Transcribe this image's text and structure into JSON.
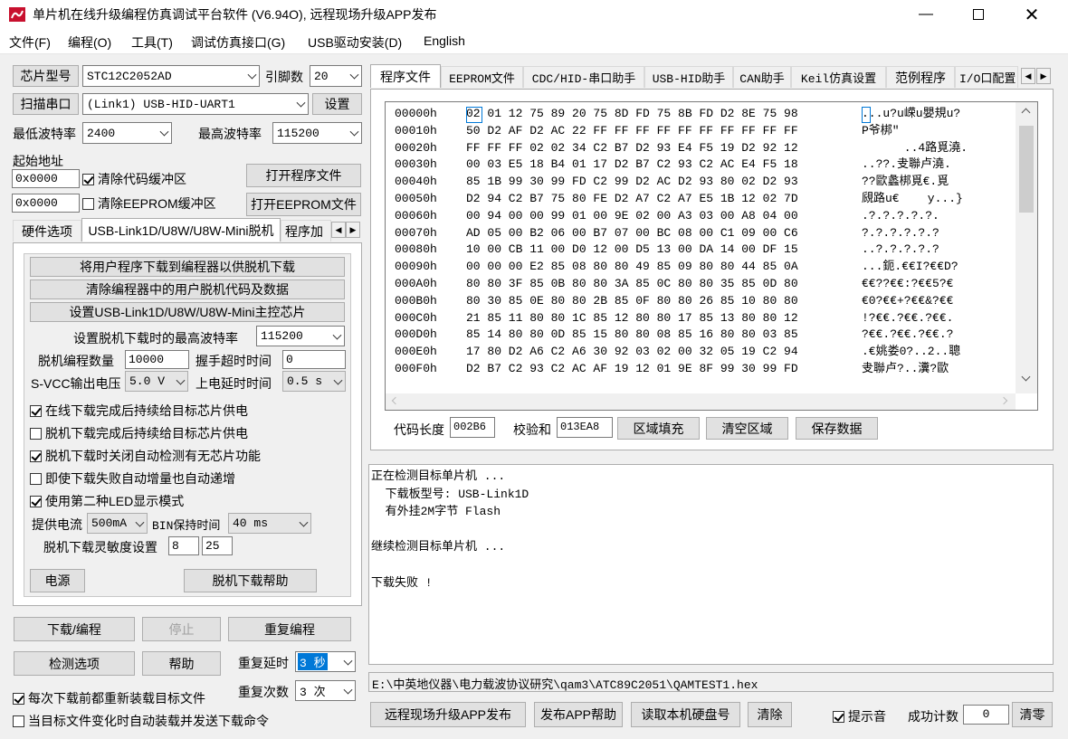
{
  "window": {
    "title": "单片机在线升级编程仿真调试平台软件 (V6.94O), 远程现场升级APP发布"
  },
  "menu": [
    "文件(F)",
    "编程(O)",
    "工具(T)",
    "调试仿真接口(G)",
    "USB驱动安装(D)",
    "English"
  ],
  "left": {
    "chip_btn": "芯片型号",
    "chip_value": "STC12C2052AD",
    "pins_label": "引脚数",
    "pins_value": "20",
    "scan_btn": "扫描串口",
    "port_value": "(Link1) USB-HID-UART1",
    "settings_btn": "设置",
    "min_baud_label": "最低波特率",
    "min_baud_value": "2400",
    "max_baud_label": "最高波特率",
    "max_baud_value": "115200",
    "start_addr_label": "起始地址",
    "code_addr": "0x0000",
    "eeprom_addr": "0x0000",
    "clear_code_label": "清除代码缓冲区",
    "clear_eeprom_label": "清除EEPROM缓冲区",
    "open_prog_btn": "打开程序文件",
    "open_eeprom_btn": "打开EEPROM文件"
  },
  "left_tabs": [
    "硬件选项",
    "USB-Link1D/U8W/U8W-Mini脱机",
    "程序加"
  ],
  "offline": {
    "btn_download": "将用户程序下载到编程器以供脱机下载",
    "btn_clear": "清除编程器中的用户脱机代码及数据",
    "btn_set_chip": "设置USB-Link1D/U8W/U8W-Mini主控芯片",
    "baud_label": "设置脱机下载时的最高波特率",
    "baud_value": "115200",
    "count_label": "脱机编程数量",
    "count_value": "10000",
    "handshake_label": "握手超时时间",
    "handshake_value": "0",
    "svcc_label": "S-VCC输出电压",
    "svcc_value": "5.0 V",
    "delay_label": "上电延时时间",
    "delay_value": "0.5 s",
    "checks": [
      {
        "label": "在线下载完成后持续给目标芯片供电",
        "on": true
      },
      {
        "label": "脱机下载完成后持续给目标芯片供电",
        "on": false
      },
      {
        "label": "脱机下载时关闭自动检测有无芯片功能",
        "on": true
      },
      {
        "label": "即使下载失败自动增量也自动递增",
        "on": false
      },
      {
        "label": "使用第二种LED显示模式",
        "on": true
      }
    ],
    "current_label": "提供电流",
    "current_value": "500mA",
    "bin_label": "BIN保持时间",
    "bin_value": "40 ms",
    "sens_label": "脱机下载灵敏度设置",
    "sens_a": "8",
    "sens_b": "25",
    "power_btn": "电源",
    "help_btn": "脱机下载帮助"
  },
  "bottom_left": {
    "download_btn": "下载/编程",
    "stop_btn": "停止",
    "repeat_btn": "重复编程",
    "detect_btn": "检测选项",
    "help_btn": "帮助",
    "repeat_delay_label": "重复延时",
    "repeat_delay_value": "3 秒",
    "repeat_count_label": "重复次数",
    "repeat_count_value": "3 次",
    "reload_label": "每次下载前都重新装载目标文件",
    "auto_label": "当目标文件变化时自动装载并发送下载命令"
  },
  "right_tabs": [
    "程序文件",
    "EEPROM文件",
    "CDC/HID-串口助手",
    "USB-HID助手",
    "CAN助手",
    "Keil仿真设置",
    "范例程序",
    "I/O口配置"
  ],
  "hex_rows": [
    {
      "addr": "00000h",
      "bytes": "02 01 12 75 89 20 75 8D FD 75 8B FD D2 8E 75 98",
      "ascii": "...u?u嵘u嬰規u?"
    },
    {
      "addr": "00010h",
      "bytes": "50 D2 AF D2 AC 22 FF FF FF FF FF FF FF FF FF FF",
      "ascii": "P爷梆\""
    },
    {
      "addr": "00020h",
      "bytes": "FF FF FF 02 02 34 C2 B7 D2 93 E4 F5 19 D2 92 12",
      "ascii": "      ..4路覓澆."
    },
    {
      "addr": "00030h",
      "bytes": "00 03 E5 18 B4 01 17 D2 B7 C2 93 C2 AC E4 F5 18",
      "ascii": "..??.叏聯卢澆."
    },
    {
      "addr": "00040h",
      "bytes": "85 1B 99 30 99 FD C2 99 D2 AC D2 93 80 02 D2 93",
      "ascii": "??歐蠡梆覓€.覓"
    },
    {
      "addr": "00050h",
      "bytes": "D2 94 C2 B7 75 80 FE D2 A7 C2 A7 E5 1B 12 02 7D",
      "ascii": "覛路u€    y...}"
    },
    {
      "addr": "00060h",
      "bytes": "00 94 00 00 99 01 00 9E 02 00 A3 03 00 A8 04 00",
      "ascii": ".?.?.?.?.?."
    },
    {
      "addr": "00070h",
      "bytes": "AD 05 00 B2 06 00 B7 07 00 BC 08 00 C1 09 00 C6",
      "ascii": "?.?.?.?.?.?"
    },
    {
      "addr": "00080h",
      "bytes": "10 00 CB 11 00 D0 12 00 D5 13 00 DA 14 00 DF 15",
      "ascii": "..?.?.?.?.?"
    },
    {
      "addr": "00090h",
      "bytes": "00 00 00 E2 85 08 80 80 49 85 09 80 80 44 85 0A",
      "ascii": "...鈪.€€I?€€D?"
    },
    {
      "addr": "000A0h",
      "bytes": "80 80 3F 85 0B 80 80 3A 85 0C 80 80 35 85 0D 80",
      "ascii": "€€??€€:?€€5?€"
    },
    {
      "addr": "000B0h",
      "bytes": "80 30 85 0E 80 80 2B 85 0F 80 80 26 85 10 80 80",
      "ascii": "€0?€€+?€€&?€€"
    },
    {
      "addr": "000C0h",
      "bytes": "21 85 11 80 80 1C 85 12 80 80 17 85 13 80 80 12",
      "ascii": "!?€€.?€€.?€€."
    },
    {
      "addr": "000D0h",
      "bytes": "85 14 80 80 0D 85 15 80 80 08 85 16 80 80 03 85",
      "ascii": "?€€.?€€.?€€.?"
    },
    {
      "addr": "000E0h",
      "bytes": "17 80 D2 A6 C2 A6 30 92 03 02 00 32 05 19 C2 94",
      "ascii": ".€姚娄0?..2..聰"
    },
    {
      "addr": "000F0h",
      "bytes": "D2 B7 C2 93 C2 AC AF 19 12 01 9E 8F 99 30 99 FD",
      "ascii": "叏聯卢?..瀵?歐"
    }
  ],
  "code_bar": {
    "len_label": "代码长度",
    "len_value": "002B6",
    "sum_label": "校验和",
    "sum_value": "013EA8",
    "fill_btn": "区域填充",
    "clear_btn": "清空区域",
    "save_btn": "保存数据"
  },
  "log": [
    "正在检测目标单片机 ...",
    "  下载板型号: USB-Link1D",
    "  有外挂2M字节 Flash",
    "",
    "继续检测目标单片机 ...",
    "",
    "下载失败 !"
  ],
  "file_path": "E:\\中英地仪器\\电力载波协议研究\\qam3\\ATC89C2051\\QAMTEST1.hex",
  "bottom_right": {
    "publish_btn": "远程现场升级APP发布",
    "publish_help_btn": "发布APP帮助",
    "read_disk_btn": "读取本机硬盘号",
    "clear_btn": "清除",
    "sound_label": "提示音",
    "success_label": "成功计数",
    "success_value": "0",
    "reset_btn": "清零"
  },
  "colors": {
    "accent": "#0078d7",
    "select_bg": "#0078d7"
  }
}
